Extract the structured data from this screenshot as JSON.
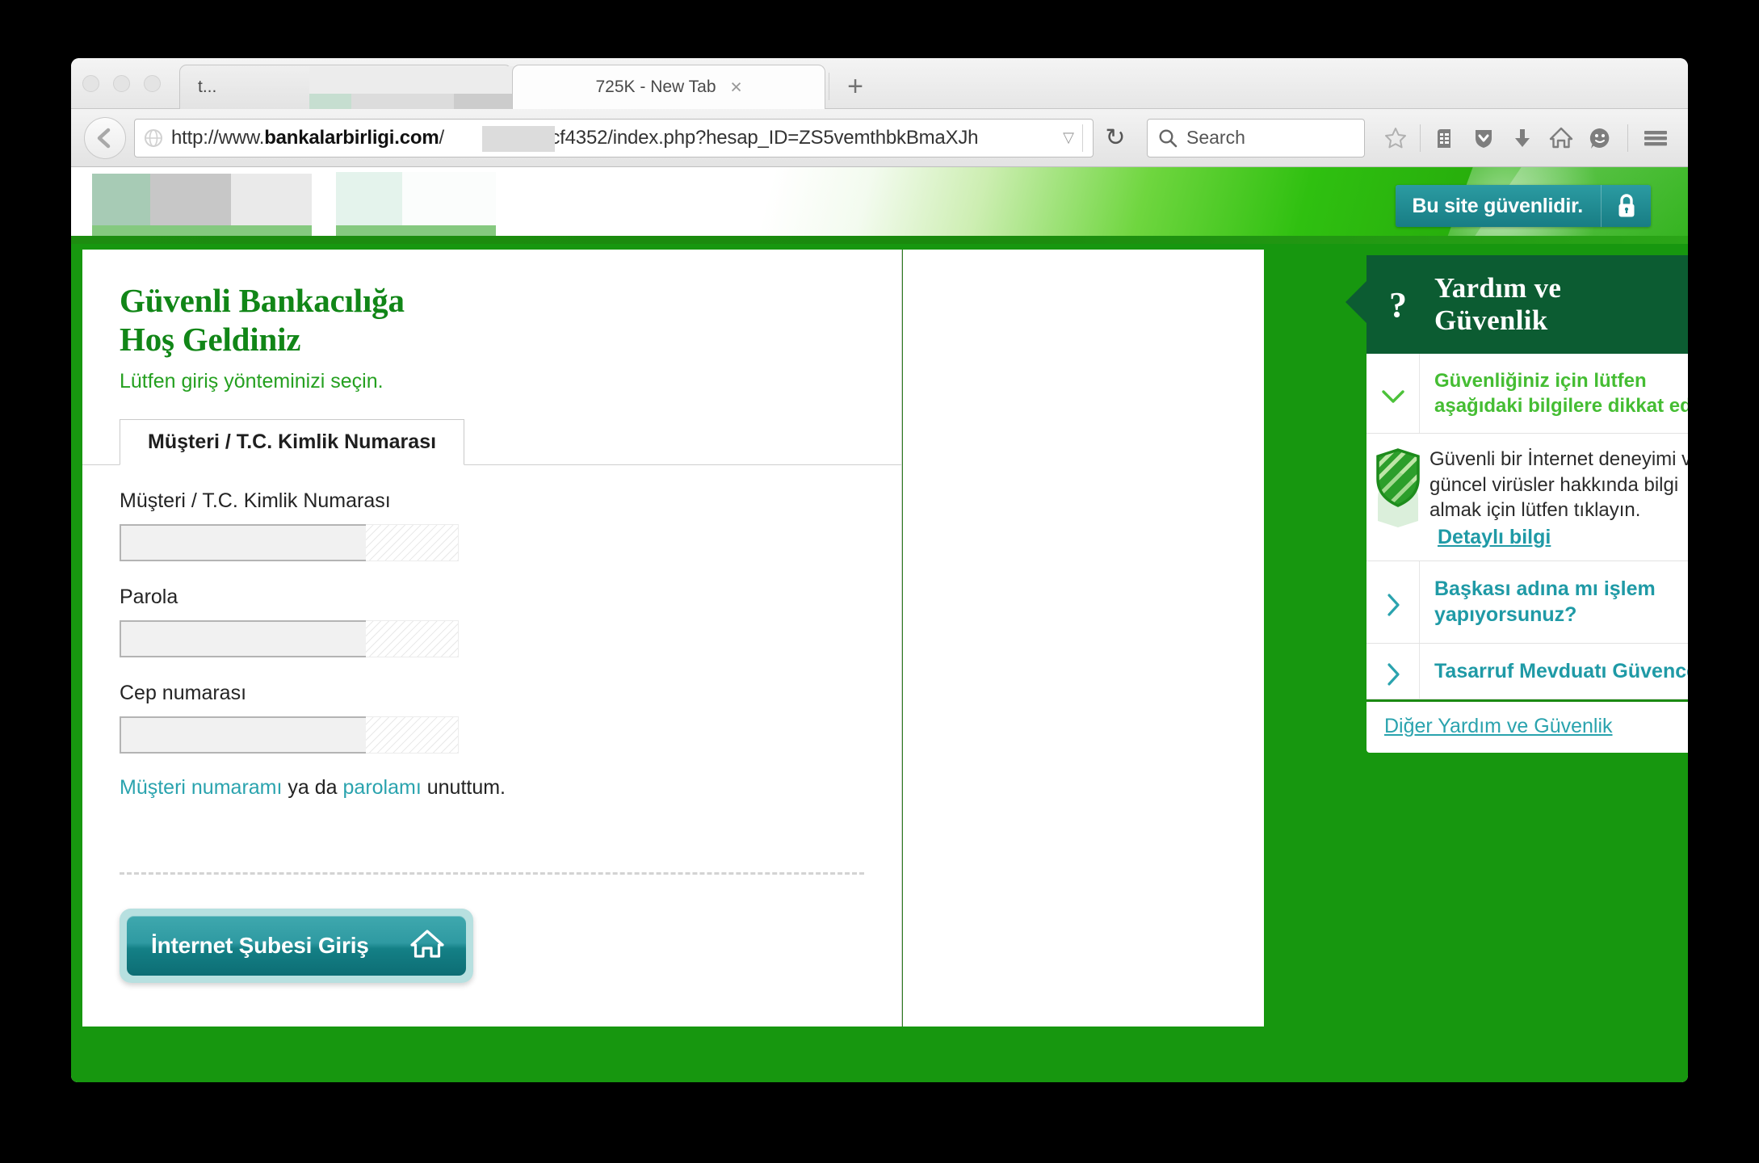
{
  "browser": {
    "tabs": [
      {
        "title": "t...",
        "redacted": true,
        "close_label": "×"
      },
      {
        "title": "725K - New Tab",
        "redacted": false,
        "close_label": "×"
      }
    ],
    "new_tab_label": "+",
    "url": {
      "scheme_host_prefix": "http://www.",
      "host": "bankalarbirligi.com",
      "path": "/",
      "path_suffix": "_3acf4352/index.php?hesap_ID=ZS5vemthbkBmaXJh",
      "full": "http://www.bankalarbirligi.com/_3acf4352/index.php?hesap_ID=ZS5vemthbkBmaXJh",
      "dropdown_glyph": "▽"
    },
    "reload_label": "↻",
    "back_label": "←",
    "search": {
      "placeholder": "Search",
      "value": ""
    },
    "toolbar_icons": [
      "star-icon",
      "reader-list-icon",
      "pocket-shield-icon",
      "download-icon",
      "home-icon",
      "smiley-icon",
      "hamburger-menu-icon"
    ]
  },
  "site": {
    "secure_badge": {
      "label": "Bu site güvenlidir.",
      "icon": "lock-icon"
    }
  },
  "login": {
    "title_line1": "Güvenli Bankacılığa",
    "title_line2": "Hoş Geldiniz",
    "subtitle": "Lütfen giriş yönteminizi seçin.",
    "tab_label": "Müşteri / T.C. Kimlik Numarası",
    "fields": [
      {
        "label": "Müşteri / T.C. Kimlik Numarası",
        "value": "",
        "name": "customer-id-field"
      },
      {
        "label": "Parola",
        "value": "",
        "name": "password-field"
      },
      {
        "label": "Cep numarası",
        "value": "",
        "name": "mobile-number-field"
      }
    ],
    "forgot": {
      "link1": "Müşteri numaramı",
      "middle": " ya da ",
      "link2": "parolamı",
      "tail": " unuttum."
    },
    "submit_label": "İnternet Şubesi Giriş",
    "submit_icon": "home-icon"
  },
  "help": {
    "header_icon": "question-mark-icon",
    "header_title_line1": "Yardım ve",
    "header_title_line2": "Güvenlik",
    "notice": "Güvenliğiniz için lütfen aşağıdaki bilgilere dikkat edin.",
    "notice_icon": "chevron-down-icon",
    "shield": {
      "icon": "shield-icon",
      "body": "Güvenli bir İnternet deneyimi ve güncel virüsler hakkında bilgi almak için lütfen tıklayın.",
      "link": "Detaylı bilgi"
    },
    "links": [
      {
        "label": "Başkası adına mı işlem yapıyorsunuz?",
        "icon": "chevron-right-icon"
      },
      {
        "label": "Tasarruf Mevduatı Güvencesi",
        "icon": "chevron-right-icon"
      }
    ],
    "footer_link": "Diğer Yardım ve Güvenlik"
  },
  "colors": {
    "brand_green": "#17970f",
    "dark_green": "#0c5c32",
    "title_green": "#118617",
    "teal": "#1f9aa6",
    "link_teal": "#2aa3ae",
    "notice_green": "#45bd33"
  }
}
